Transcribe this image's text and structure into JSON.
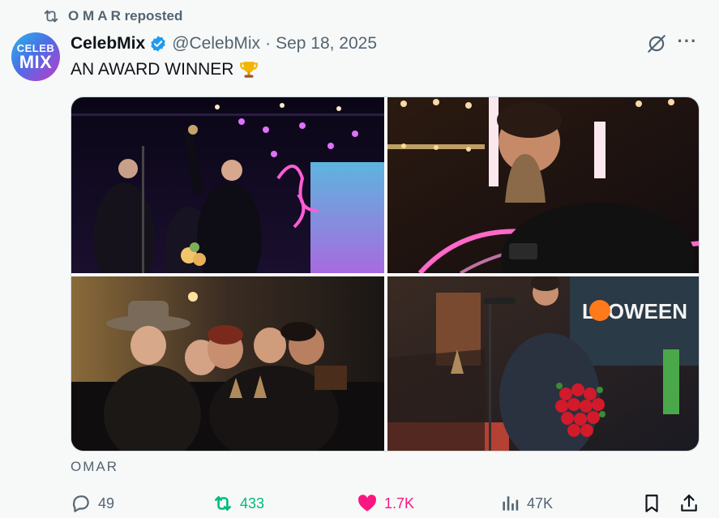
{
  "repost": {
    "text": "O M A R reposted",
    "icon": "repost-icon"
  },
  "author": {
    "avatar_line1": "CELEB",
    "avatar_line2": "MIX",
    "name": "CelebMix",
    "handle": "@CelebMix",
    "separator": "·",
    "date": "Sep 18, 2025",
    "verified": true
  },
  "tweet": {
    "text": "AN AWARD WINNER",
    "emoji": "trophy-icon"
  },
  "media": {
    "count": 4,
    "photos": [
      "award-stage-photo",
      "trophy-kiss-photo",
      "group-celebration-photo",
      "roses-speech-photo"
    ]
  },
  "source_label": "OMAR",
  "actions": {
    "replies": "49",
    "reposts": "433",
    "likes": "1.7K",
    "views": "47K"
  },
  "colors": {
    "text": "#0f1419",
    "secondary": "#536471",
    "repost_active": "#00ba7c",
    "like_active": "#f91880",
    "verified": "#1d9bf0",
    "background": "#f7f9f9"
  }
}
